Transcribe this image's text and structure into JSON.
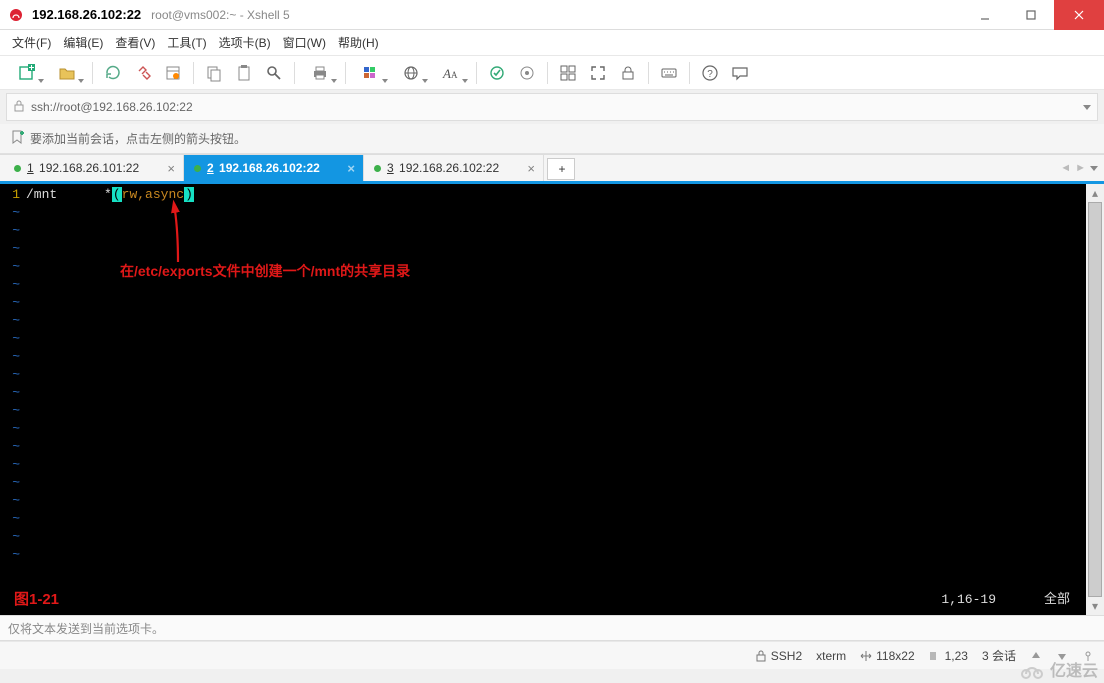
{
  "window": {
    "title_bold": "192.168.26.102:22",
    "title_sub": "root@vms002:~ - Xshell 5"
  },
  "menu": {
    "file": "文件(F)",
    "edit": "编辑(E)",
    "view": "查看(V)",
    "tools": "工具(T)",
    "tabs": "选项卡(B)",
    "window": "窗口(W)",
    "help": "帮助(H)"
  },
  "address": {
    "value": "ssh://root@192.168.26.102:22"
  },
  "hint": {
    "text": "要添加当前会话，点击左侧的箭头按钮。"
  },
  "tabs": {
    "items": [
      {
        "num": "1",
        "label": "192.168.26.101:22"
      },
      {
        "num": "2",
        "label": "192.168.26.102:22"
      },
      {
        "num": "3",
        "label": "192.168.26.102:22"
      }
    ],
    "add": "+"
  },
  "terminal": {
    "line1_no": "1",
    "line1_path": "/mnt",
    "line1_star": "*",
    "line1_par_open": "(",
    "line1_opts": "rw,async",
    "line1_par_close": ")",
    "tilde": "~",
    "annotation": "在/etc/exports文件中创建一个/mnt的共享目录",
    "figure_label": "图1-21",
    "position": "1,16-19",
    "all_label": "全部"
  },
  "input": {
    "placeholder": "仅将文本发送到当前选项卡。"
  },
  "status": {
    "ssh": "SSH2",
    "term": "xterm",
    "size": "118x22",
    "cursor": "1,23",
    "sessions": "3 会话"
  },
  "watermark": {
    "text": "亿速云"
  }
}
